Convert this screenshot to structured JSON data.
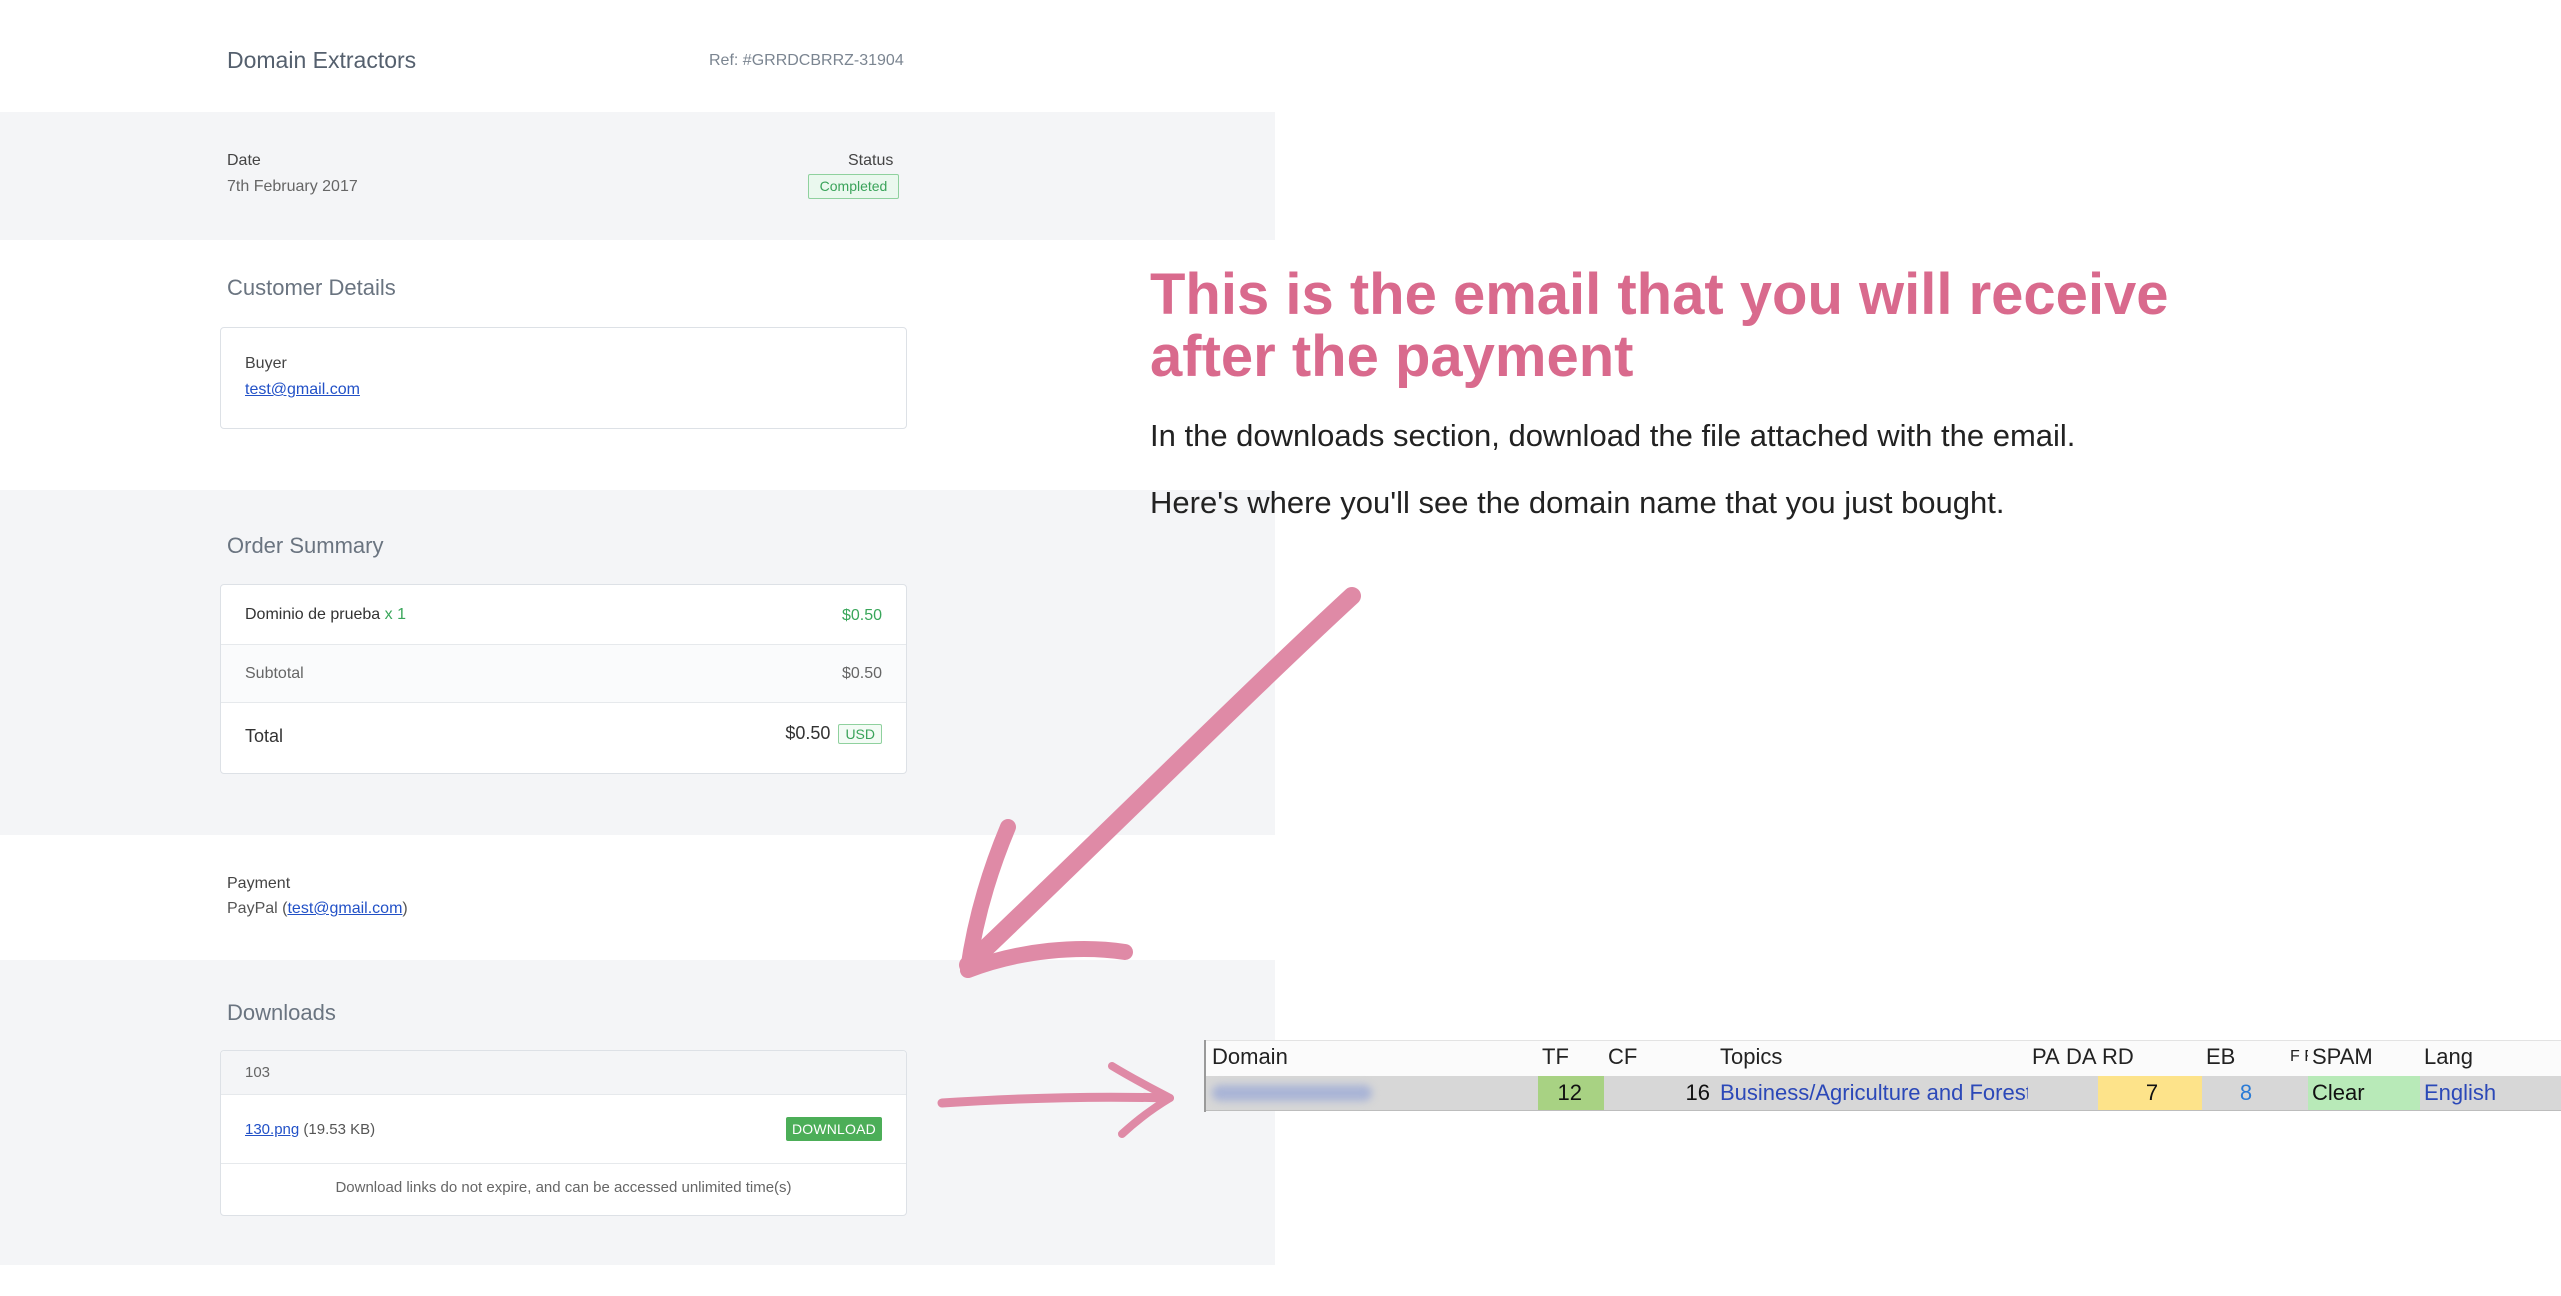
{
  "receipt": {
    "title": "Domain Extractors",
    "ref": "Ref: #GRRDCBRRZ-31904",
    "date_label": "Date",
    "date_value": "7th February 2017",
    "status_label": "Status",
    "status_value": "Completed",
    "customer_heading": "Customer Details",
    "buyer_label": "Buyer",
    "buyer_email": "test@gmail.com",
    "order_heading": "Order Summary",
    "item_name": "Dominio de prueba",
    "item_qty": "x 1",
    "item_price": "$0.50",
    "subtotal_label": "Subtotal",
    "subtotal_value": "$0.50",
    "total_label": "Total",
    "total_value": "$0.50",
    "currency": "USD",
    "payment_label": "Payment",
    "payment_method": "PayPal (",
    "payment_email": "test@gmail.com",
    "payment_close": ")",
    "downloads_heading": "Downloads",
    "download_group": "103",
    "file_name": "130.png",
    "file_size": "(19.53 KB)",
    "download_button": "DOWNLOAD",
    "download_note": "Download links do not expire, and can be accessed unlimited time(s)"
  },
  "instructions": {
    "heading": "This is the email that you will receive after the payment",
    "line1": "In the downloads section, download the file attached with the email.",
    "line2": "Here's where you'll see the domain name that you just bought."
  },
  "sheet": {
    "headers": [
      "Domain",
      "TF",
      "CF",
      "Topics",
      "PA",
      "DA",
      "RD",
      "EB",
      "F F",
      "SPAM",
      "Lang"
    ],
    "row": {
      "domain": "",
      "tf": "12",
      "cf": "16",
      "topics": "Business/Agriculture and Forestry; R",
      "pa": "",
      "da": "",
      "rd": "7",
      "eb": "8",
      "spam": "Clear",
      "lang": "English"
    }
  },
  "colors": {
    "accent_pink": "#d96a8d",
    "status_green": "#3aa35a",
    "link_blue": "#2251c7",
    "band_gray": "#f4f5f7"
  }
}
